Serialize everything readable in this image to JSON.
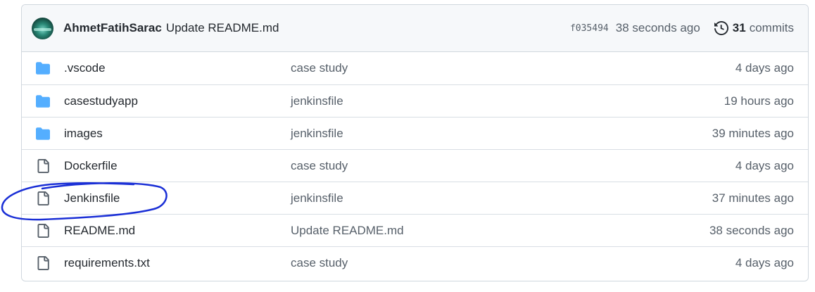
{
  "latest_commit": {
    "author": "AhmetFatihSarac",
    "message": "Update README.md",
    "sha": "f035494",
    "time": "38 seconds ago",
    "commits_count": "31",
    "commits_label": "commits"
  },
  "files": [
    {
      "name": ".vscode",
      "type": "folder",
      "message": "case study",
      "age": "4 days ago"
    },
    {
      "name": "casestudyapp",
      "type": "folder",
      "message": "jenkinsfile",
      "age": "19 hours ago"
    },
    {
      "name": "images",
      "type": "folder",
      "message": "jenkinsfile",
      "age": "39 minutes ago"
    },
    {
      "name": "Dockerfile",
      "type": "file",
      "message": "case study",
      "age": "4 days ago"
    },
    {
      "name": "Jenkinsfile",
      "type": "file",
      "message": "jenkinsfile",
      "age": "37 minutes ago"
    },
    {
      "name": "README.md",
      "type": "file",
      "message": "Update README.md",
      "age": "38 seconds ago"
    },
    {
      "name": "requirements.txt",
      "type": "file",
      "message": "case study",
      "age": "4 days ago"
    }
  ],
  "colors": {
    "folder": "#54aeff",
    "annotation": "#1a2fd6"
  }
}
